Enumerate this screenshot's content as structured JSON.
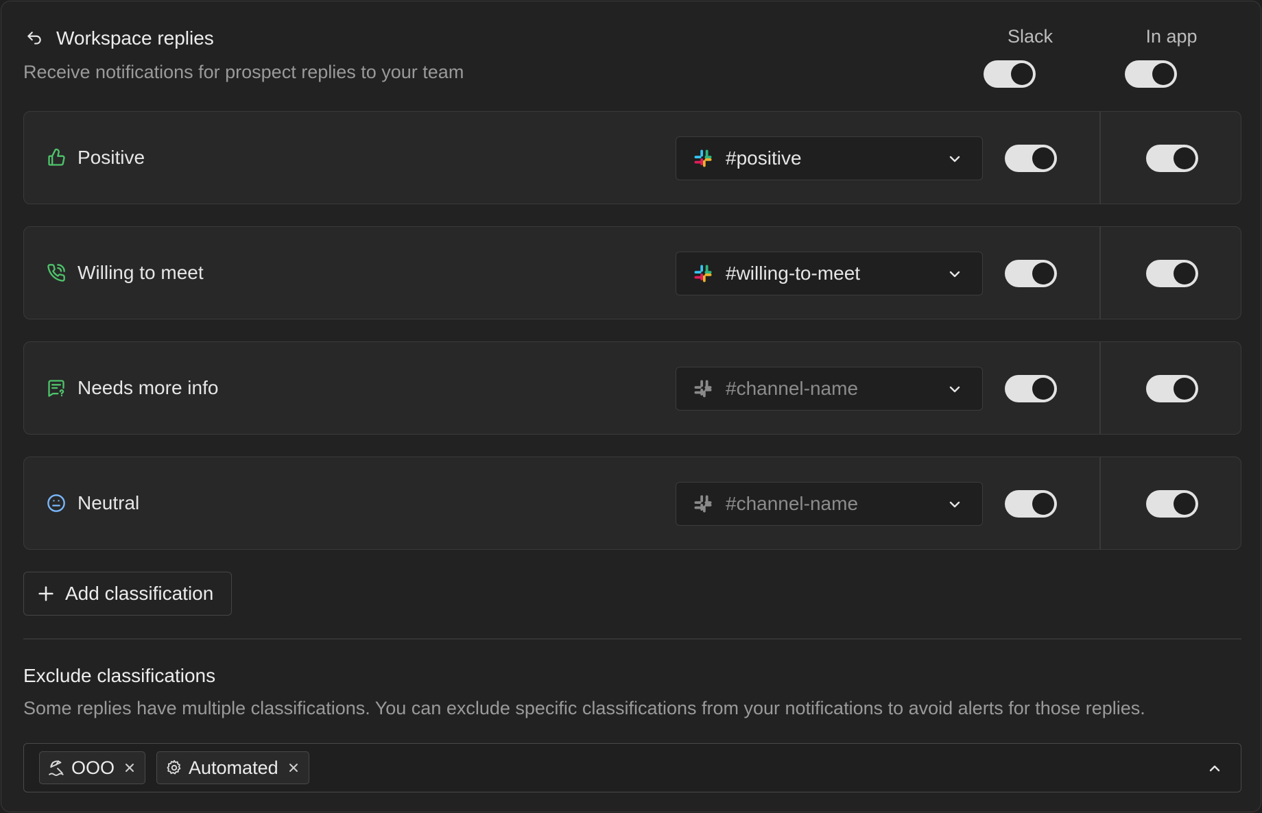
{
  "header": {
    "title": "Workspace replies",
    "subtitle": "Receive notifications for prospect replies to your team",
    "columns": {
      "slack": "Slack",
      "in_app": "In app"
    },
    "slack_enabled": true,
    "in_app_enabled": true
  },
  "rows": [
    {
      "label": "Positive",
      "icon": "thumbs-up-icon",
      "channel": "#positive",
      "channel_is_placeholder": false,
      "slack": true,
      "in_app": true
    },
    {
      "label": "Willing to meet",
      "icon": "phone-call-icon",
      "channel": "#willing-to-meet",
      "channel_is_placeholder": false,
      "slack": true,
      "in_app": true
    },
    {
      "label": "Needs more info",
      "icon": "message-question-icon",
      "channel": "#channel-name",
      "channel_is_placeholder": true,
      "slack": true,
      "in_app": true
    },
    {
      "label": "Neutral",
      "icon": "neutral-face-icon",
      "channel": "#channel-name",
      "channel_is_placeholder": true,
      "slack": true,
      "in_app": true
    }
  ],
  "add_button": {
    "label": "Add classification"
  },
  "exclude": {
    "title": "Exclude classifications",
    "description": "Some replies have multiple classifications. You can exclude specific classifications from your notifications to avoid alerts for those replies.",
    "chips": [
      {
        "label": "OOO",
        "icon": "beach-umbrella-icon"
      },
      {
        "label": "Automated",
        "icon": "gear-icon"
      }
    ]
  },
  "colors": {
    "accent_green": "#4ec46b",
    "accent_blue": "#7ab8ff",
    "toggle_on": "#e2e2e2"
  }
}
